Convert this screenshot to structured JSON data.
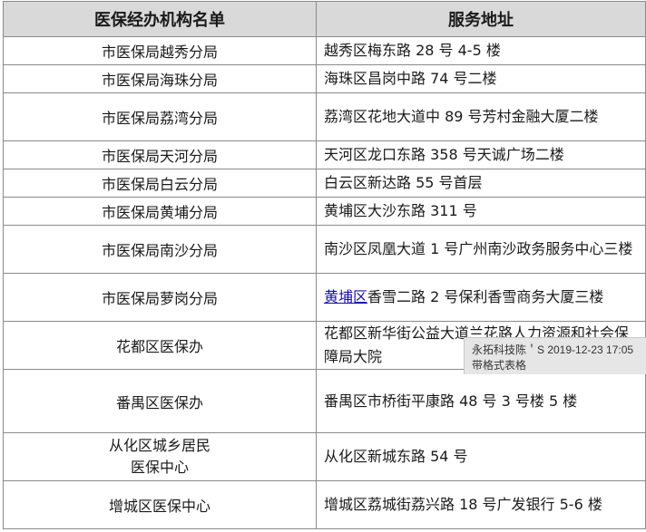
{
  "header": {
    "col1": "医保经办机构名单",
    "col2": "服务地址"
  },
  "rows": [
    {
      "name": "市医保局越秀分局",
      "address": "越秀区梅东路 28 号 4-5 楼"
    },
    {
      "name": "市医保局海珠分局",
      "address": "海珠区昌岗中路 74 号二楼"
    },
    {
      "name": "市医保局荔湾分局",
      "address": "荔湾区花地大道中 89 号芳村金融大厦二楼"
    },
    {
      "name": "市医保局天河分局",
      "address": "天河区龙口东路 358 号天诚广场二楼"
    },
    {
      "name": "市医保局白云分局",
      "address": "白云区新达路 55 号首层"
    },
    {
      "name": "市医保局黄埔分局",
      "address": "黄埔区大沙东路 311  号"
    },
    {
      "name": "市医保局南沙分局",
      "address": "南沙区凤凰大道 1 号广州南沙政务服务中心三楼"
    },
    {
      "name": "市医保局萝岗分局",
      "address_link": "黄埔区",
      "address_rest": "香雪二路 2 号保利香雪商务大厦三楼"
    },
    {
      "name": "花都区医保办",
      "address": "花都区新华街公益大道兰花路人力资源和社会保障局大院"
    },
    {
      "name": "番禺区医保办",
      "address": "番禺区市桥街平康路 48 号 3 号楼 5 楼"
    },
    {
      "name_line1": "从化区城乡居民",
      "name_line2": "医保中心",
      "address": "从化区新城东路 54 号"
    },
    {
      "name": "增城区医保中心",
      "address": "增城区荔城街荔兴路 18 号广发银行 5-6 楼"
    }
  ],
  "comment": {
    "author_time": "永拓科技陈＇S 2019-12-23 17:05",
    "note": "带格式表格"
  }
}
